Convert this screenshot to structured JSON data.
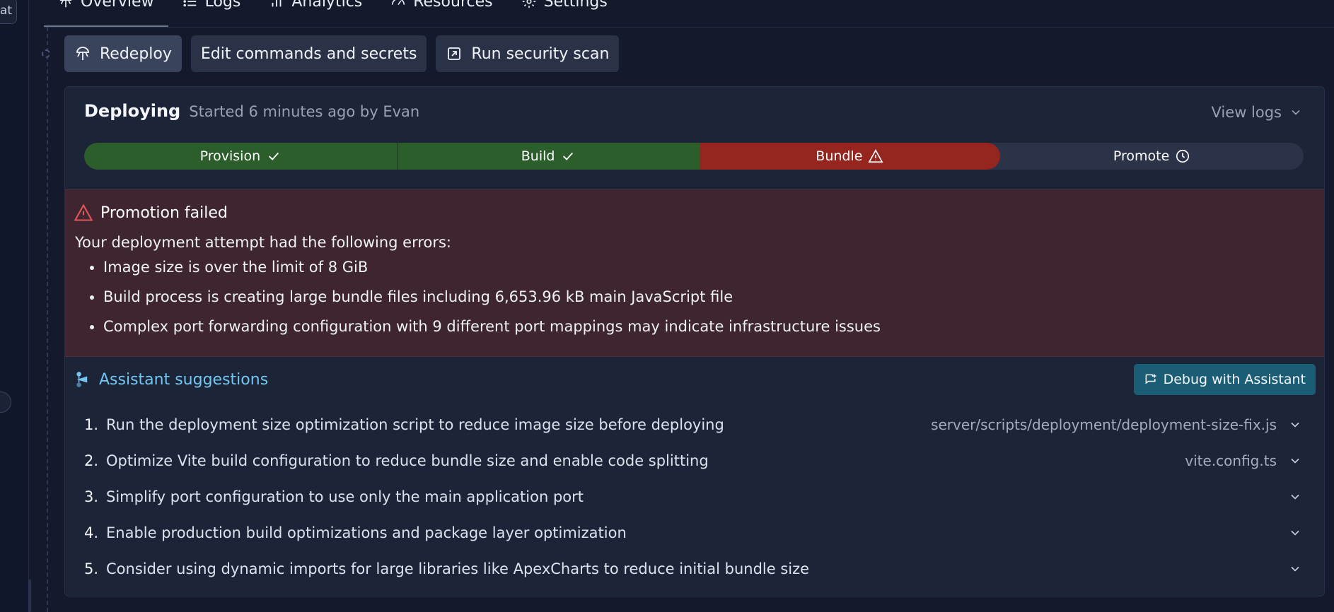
{
  "left_rail": {
    "chip_text": "at"
  },
  "tabs": [
    {
      "label": "Overview",
      "icon": "deploy-icon"
    },
    {
      "label": "Logs",
      "icon": "list-icon"
    },
    {
      "label": "Analytics",
      "icon": "bar-chart-icon"
    },
    {
      "label": "Resources",
      "icon": "gauge-icon"
    },
    {
      "label": "Settings",
      "icon": "gear-icon"
    }
  ],
  "actions": {
    "redeploy": "Redeploy",
    "edit": "Edit commands and secrets",
    "security": "Run security scan"
  },
  "deploy": {
    "title": "Deploying",
    "subtitle": "Started 6 minutes ago by Evan",
    "view_logs": "View logs"
  },
  "steps": [
    {
      "label": "Provision",
      "status": "done"
    },
    {
      "label": "Build",
      "status": "done"
    },
    {
      "label": "Bundle",
      "status": "error"
    },
    {
      "label": "Promote",
      "status": "pending"
    }
  ],
  "error": {
    "title": "Promotion failed",
    "intro": "Your deployment attempt had the following errors:",
    "items": [
      "Image size is over the limit of 8 GiB",
      "Build process is creating large bundle files including 6,653.96 kB main JavaScript file",
      "Complex port forwarding configuration with 9 different port mappings may indicate infrastructure issues"
    ]
  },
  "assistant": {
    "title": "Assistant suggestions",
    "debug_button": "Debug with Assistant",
    "suggestions": [
      {
        "num": "1.",
        "text": "Run the deployment size optimization script to reduce image size before deploying",
        "file": "server/scripts/deployment/deployment-size-fix.js"
      },
      {
        "num": "2.",
        "text": "Optimize Vite build configuration to reduce bundle size and enable code splitting",
        "file": "vite.config.ts"
      },
      {
        "num": "3.",
        "text": "Simplify port configuration to use only the main application port",
        "file": ""
      },
      {
        "num": "4.",
        "text": "Enable production build optimizations and package layer optimization",
        "file": ""
      },
      {
        "num": "5.",
        "text": "Consider using dynamic imports for large libraries like ApexCharts to reduce initial bundle size",
        "file": ""
      }
    ]
  },
  "colors": {
    "success": "#2b5e2b",
    "error": "#962520",
    "accent": "#73c6ef",
    "debug_button": "#1c5d76"
  }
}
